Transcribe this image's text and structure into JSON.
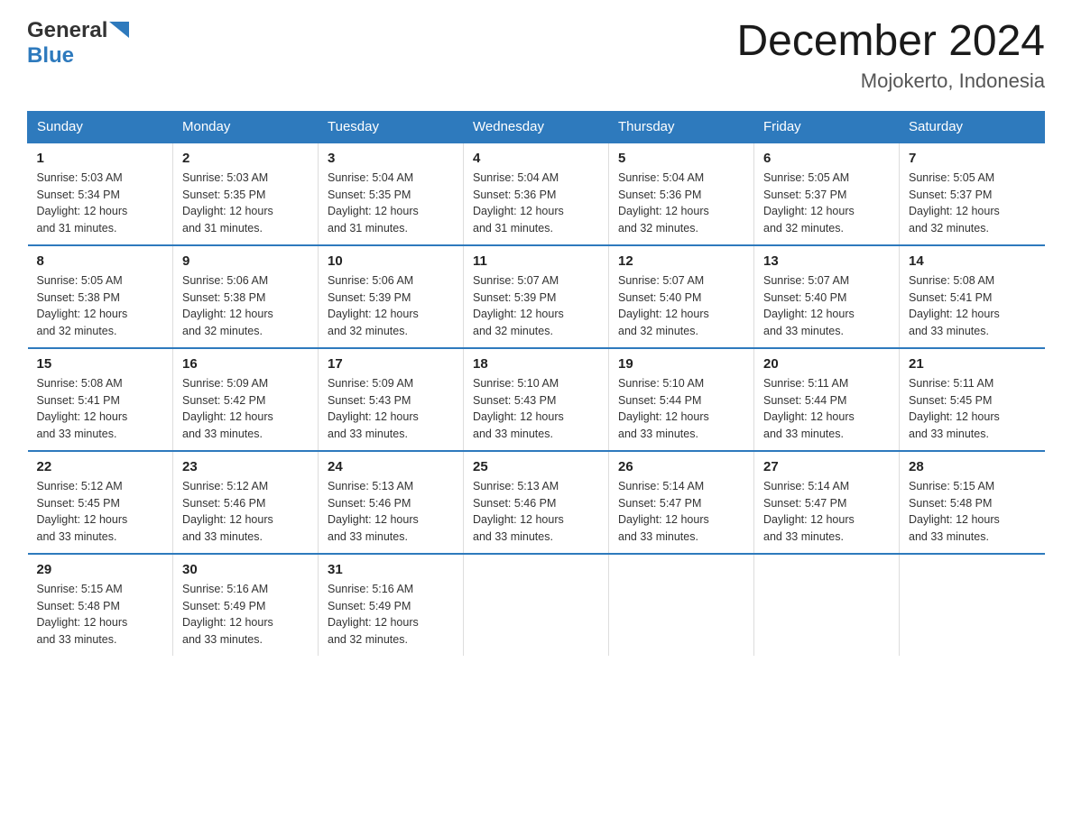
{
  "header": {
    "logo_general": "General",
    "logo_blue": "Blue",
    "month_year": "December 2024",
    "location": "Mojokerto, Indonesia"
  },
  "days_of_week": [
    "Sunday",
    "Monday",
    "Tuesday",
    "Wednesday",
    "Thursday",
    "Friday",
    "Saturday"
  ],
  "weeks": [
    [
      {
        "day": "1",
        "sunrise": "5:03 AM",
        "sunset": "5:34 PM",
        "daylight": "12 hours and 31 minutes."
      },
      {
        "day": "2",
        "sunrise": "5:03 AM",
        "sunset": "5:35 PM",
        "daylight": "12 hours and 31 minutes."
      },
      {
        "day": "3",
        "sunrise": "5:04 AM",
        "sunset": "5:35 PM",
        "daylight": "12 hours and 31 minutes."
      },
      {
        "day": "4",
        "sunrise": "5:04 AM",
        "sunset": "5:36 PM",
        "daylight": "12 hours and 31 minutes."
      },
      {
        "day": "5",
        "sunrise": "5:04 AM",
        "sunset": "5:36 PM",
        "daylight": "12 hours and 32 minutes."
      },
      {
        "day": "6",
        "sunrise": "5:05 AM",
        "sunset": "5:37 PM",
        "daylight": "12 hours and 32 minutes."
      },
      {
        "day": "7",
        "sunrise": "5:05 AM",
        "sunset": "5:37 PM",
        "daylight": "12 hours and 32 minutes."
      }
    ],
    [
      {
        "day": "8",
        "sunrise": "5:05 AM",
        "sunset": "5:38 PM",
        "daylight": "12 hours and 32 minutes."
      },
      {
        "day": "9",
        "sunrise": "5:06 AM",
        "sunset": "5:38 PM",
        "daylight": "12 hours and 32 minutes."
      },
      {
        "day": "10",
        "sunrise": "5:06 AM",
        "sunset": "5:39 PM",
        "daylight": "12 hours and 32 minutes."
      },
      {
        "day": "11",
        "sunrise": "5:07 AM",
        "sunset": "5:39 PM",
        "daylight": "12 hours and 32 minutes."
      },
      {
        "day": "12",
        "sunrise": "5:07 AM",
        "sunset": "5:40 PM",
        "daylight": "12 hours and 32 minutes."
      },
      {
        "day": "13",
        "sunrise": "5:07 AM",
        "sunset": "5:40 PM",
        "daylight": "12 hours and 33 minutes."
      },
      {
        "day": "14",
        "sunrise": "5:08 AM",
        "sunset": "5:41 PM",
        "daylight": "12 hours and 33 minutes."
      }
    ],
    [
      {
        "day": "15",
        "sunrise": "5:08 AM",
        "sunset": "5:41 PM",
        "daylight": "12 hours and 33 minutes."
      },
      {
        "day": "16",
        "sunrise": "5:09 AM",
        "sunset": "5:42 PM",
        "daylight": "12 hours and 33 minutes."
      },
      {
        "day": "17",
        "sunrise": "5:09 AM",
        "sunset": "5:43 PM",
        "daylight": "12 hours and 33 minutes."
      },
      {
        "day": "18",
        "sunrise": "5:10 AM",
        "sunset": "5:43 PM",
        "daylight": "12 hours and 33 minutes."
      },
      {
        "day": "19",
        "sunrise": "5:10 AM",
        "sunset": "5:44 PM",
        "daylight": "12 hours and 33 minutes."
      },
      {
        "day": "20",
        "sunrise": "5:11 AM",
        "sunset": "5:44 PM",
        "daylight": "12 hours and 33 minutes."
      },
      {
        "day": "21",
        "sunrise": "5:11 AM",
        "sunset": "5:45 PM",
        "daylight": "12 hours and 33 minutes."
      }
    ],
    [
      {
        "day": "22",
        "sunrise": "5:12 AM",
        "sunset": "5:45 PM",
        "daylight": "12 hours and 33 minutes."
      },
      {
        "day": "23",
        "sunrise": "5:12 AM",
        "sunset": "5:46 PM",
        "daylight": "12 hours and 33 minutes."
      },
      {
        "day": "24",
        "sunrise": "5:13 AM",
        "sunset": "5:46 PM",
        "daylight": "12 hours and 33 minutes."
      },
      {
        "day": "25",
        "sunrise": "5:13 AM",
        "sunset": "5:46 PM",
        "daylight": "12 hours and 33 minutes."
      },
      {
        "day": "26",
        "sunrise": "5:14 AM",
        "sunset": "5:47 PM",
        "daylight": "12 hours and 33 minutes."
      },
      {
        "day": "27",
        "sunrise": "5:14 AM",
        "sunset": "5:47 PM",
        "daylight": "12 hours and 33 minutes."
      },
      {
        "day": "28",
        "sunrise": "5:15 AM",
        "sunset": "5:48 PM",
        "daylight": "12 hours and 33 minutes."
      }
    ],
    [
      {
        "day": "29",
        "sunrise": "5:15 AM",
        "sunset": "5:48 PM",
        "daylight": "12 hours and 33 minutes."
      },
      {
        "day": "30",
        "sunrise": "5:16 AM",
        "sunset": "5:49 PM",
        "daylight": "12 hours and 33 minutes."
      },
      {
        "day": "31",
        "sunrise": "5:16 AM",
        "sunset": "5:49 PM",
        "daylight": "12 hours and 32 minutes."
      },
      null,
      null,
      null,
      null
    ]
  ],
  "labels": {
    "sunrise": "Sunrise:",
    "sunset": "Sunset:",
    "daylight": "Daylight:"
  },
  "colors": {
    "header_bg": "#2e7abd",
    "border": "#2e7abd",
    "accent_blue": "#1a6faf"
  }
}
